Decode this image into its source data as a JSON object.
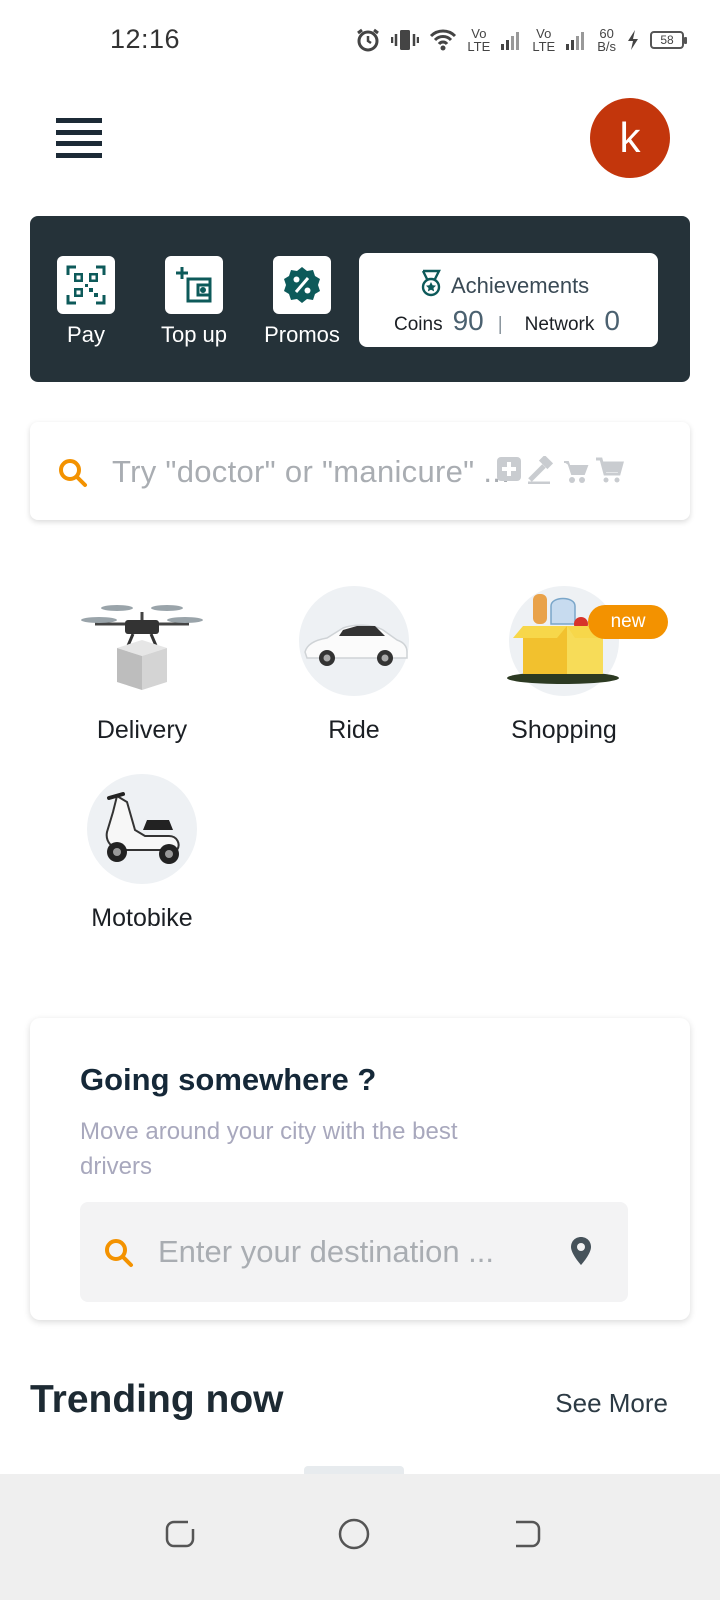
{
  "status_bar": {
    "time": "12:16",
    "net_speed_value": "60",
    "net_speed_unit": "B/s",
    "battery": "58",
    "vo_label": "Vo",
    "lte_label": "LTE",
    "icons": [
      "alarm-icon",
      "vibrate-icon",
      "wifi-icon",
      "signal-icon",
      "charging-icon",
      "battery-icon"
    ]
  },
  "header": {
    "avatar_letter": "k",
    "avatar_color": "#c3360c"
  },
  "wallet": {
    "actions": [
      {
        "label": "Pay",
        "icon": "qr-code-icon"
      },
      {
        "label": "Top up",
        "icon": "wallet-add-icon"
      },
      {
        "label": "Promos",
        "icon": "percent-badge-icon"
      }
    ],
    "achievements": {
      "title": "Achievements",
      "coins_label": "Coins",
      "coins_value": "90",
      "separator": "|",
      "network_label": "Network",
      "network_value": "0"
    },
    "background": "#253239"
  },
  "search": {
    "placeholder": "Try \"doctor\" or \"manicure\" ..."
  },
  "services": [
    {
      "label": "Delivery",
      "icon": "drone-delivery-icon"
    },
    {
      "label": "Ride",
      "icon": "car-icon"
    },
    {
      "label": "Shopping",
      "icon": "grocery-box-icon",
      "badge": "new"
    },
    {
      "label": "Motobike",
      "icon": "scooter-icon"
    }
  ],
  "going": {
    "title": "Going somewhere ?",
    "subtitle": "Move around your city with the best drivers",
    "placeholder": "Enter your destination ..."
  },
  "trending": {
    "title": "Trending now",
    "see_more": "See More"
  },
  "colors": {
    "accent": "#f39200",
    "brand_dark": "#253239",
    "teal": "#0d5a5a"
  }
}
